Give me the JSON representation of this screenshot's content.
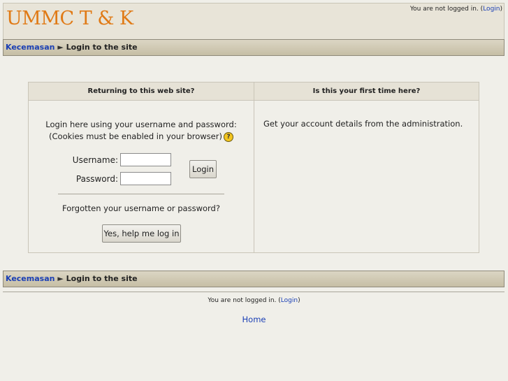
{
  "header": {
    "site_title": "UMMC T & K",
    "login_status_prefix": "You are not logged in. (",
    "login_link": "Login",
    "login_status_suffix": ")"
  },
  "breadcrumb": {
    "home_link": "Kecemasan",
    "separator": "►",
    "current": "Login to the site"
  },
  "login_box": {
    "left_heading": "Returning to this web site?",
    "right_heading": "Is this your first time here?",
    "intro_line1": "Login here using your username and password:",
    "intro_line2": "(Cookies must be enabled in your browser)",
    "help_icon_glyph": "?",
    "username_label": "Username:",
    "username_value": "",
    "password_label": "Password:",
    "password_value": "",
    "login_button": "Login",
    "forgot_text": "Forgotten your username or password?",
    "help_button": "Yes, help me log in",
    "first_time_text": "Get your account details from the administration."
  },
  "footer": {
    "login_status_prefix": "You are not logged in. (",
    "login_link": "Login",
    "login_status_suffix": ")",
    "home_link": "Home"
  },
  "colors": {
    "background": "#f0efe9",
    "title": "#e07a16",
    "link": "#1a3fb5",
    "help_icon": "#f3c51e"
  }
}
